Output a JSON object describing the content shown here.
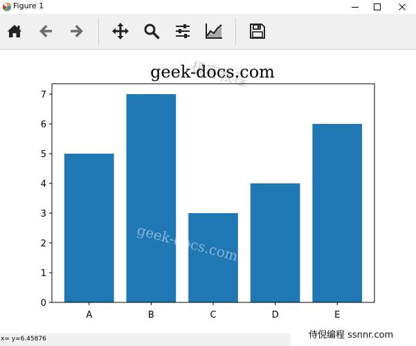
{
  "window": {
    "title": "Figure 1",
    "controls": {
      "minimize": "minimize",
      "maximize": "maximize",
      "close": "close"
    }
  },
  "toolbar": {
    "buttons": [
      {
        "name": "home-button",
        "icon": "home-icon"
      },
      {
        "name": "back-button",
        "icon": "arrow-left-icon"
      },
      {
        "name": "forward-button",
        "icon": "arrow-right-icon"
      },
      {
        "name": "pan-button",
        "icon": "move-icon"
      },
      {
        "name": "zoom-button",
        "icon": "magnifier-icon"
      },
      {
        "name": "configure-subplots-button",
        "icon": "sliders-icon"
      },
      {
        "name": "edit-axis-button",
        "icon": "line-chart-icon"
      },
      {
        "name": "save-button",
        "icon": "floppy-disk-icon"
      }
    ]
  },
  "chart_data": {
    "type": "bar",
    "title": "geek-docs.com",
    "categories": [
      "A",
      "B",
      "C",
      "D",
      "E"
    ],
    "values": [
      5,
      7,
      3,
      4,
      6
    ],
    "xlabel": "",
    "ylabel": "",
    "ylim": [
      0,
      7.35
    ],
    "yticks": [
      0,
      1,
      2,
      3,
      4,
      5,
      6,
      7
    ],
    "bar_color": "#1f77b4",
    "grid": false
  },
  "watermarks": {
    "top": "极客教程",
    "middle": "geek-docs.com"
  },
  "status": {
    "coords": "x= y=6.45876"
  },
  "credit": "侍倪编程 ssnnr.com"
}
